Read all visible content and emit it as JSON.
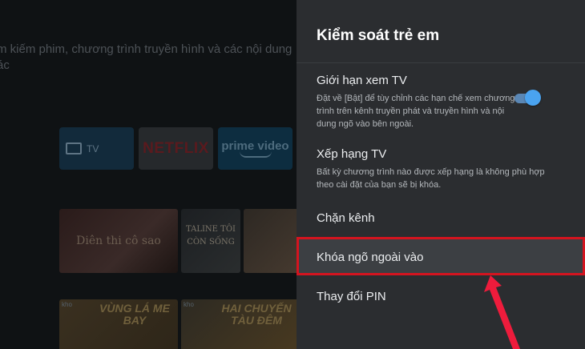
{
  "background": {
    "line1": "m kiếm phim, chương trình truyền hình và các nội dung",
    "line2": "ác",
    "apps": {
      "tv": "TV",
      "netflix": "NETFLIX",
      "prime": "prime video"
    },
    "thumbs": {
      "t1": "Diên thi cô sao",
      "t3": "TALINE TÔI CÒN SỐNG",
      "t5": "VÙNG LÁ ME BAY",
      "t6": "HAI CHUYẾN TÀU ĐÊM",
      "badge": "kho"
    }
  },
  "panel": {
    "title": "Kiểm soát trẻ em",
    "items": [
      {
        "title": "Giới hạn xem TV",
        "desc": "Đặt về [Bật] để tùy chỉnh các hạn chế xem chương trình trên kênh truyền phát và truyền hình và nội dung ngõ vào bên ngoài.",
        "toggle_on": true
      },
      {
        "title": "Xếp hạng TV",
        "desc": "Bất kỳ chương trình nào được xếp hạng là không phù hợp theo cài đặt của bạn sẽ bị khóa."
      },
      {
        "title": "Chặn kênh"
      },
      {
        "title": "Khóa ngõ ngoài vào",
        "highlighted": true
      },
      {
        "title": "Thay đổi PIN"
      }
    ]
  },
  "colors": {
    "panel_bg": "#2b2d30",
    "highlight_border": "#d4141f",
    "toggle_accent": "#4aa3f0",
    "arrow": "#ee1c3c"
  }
}
